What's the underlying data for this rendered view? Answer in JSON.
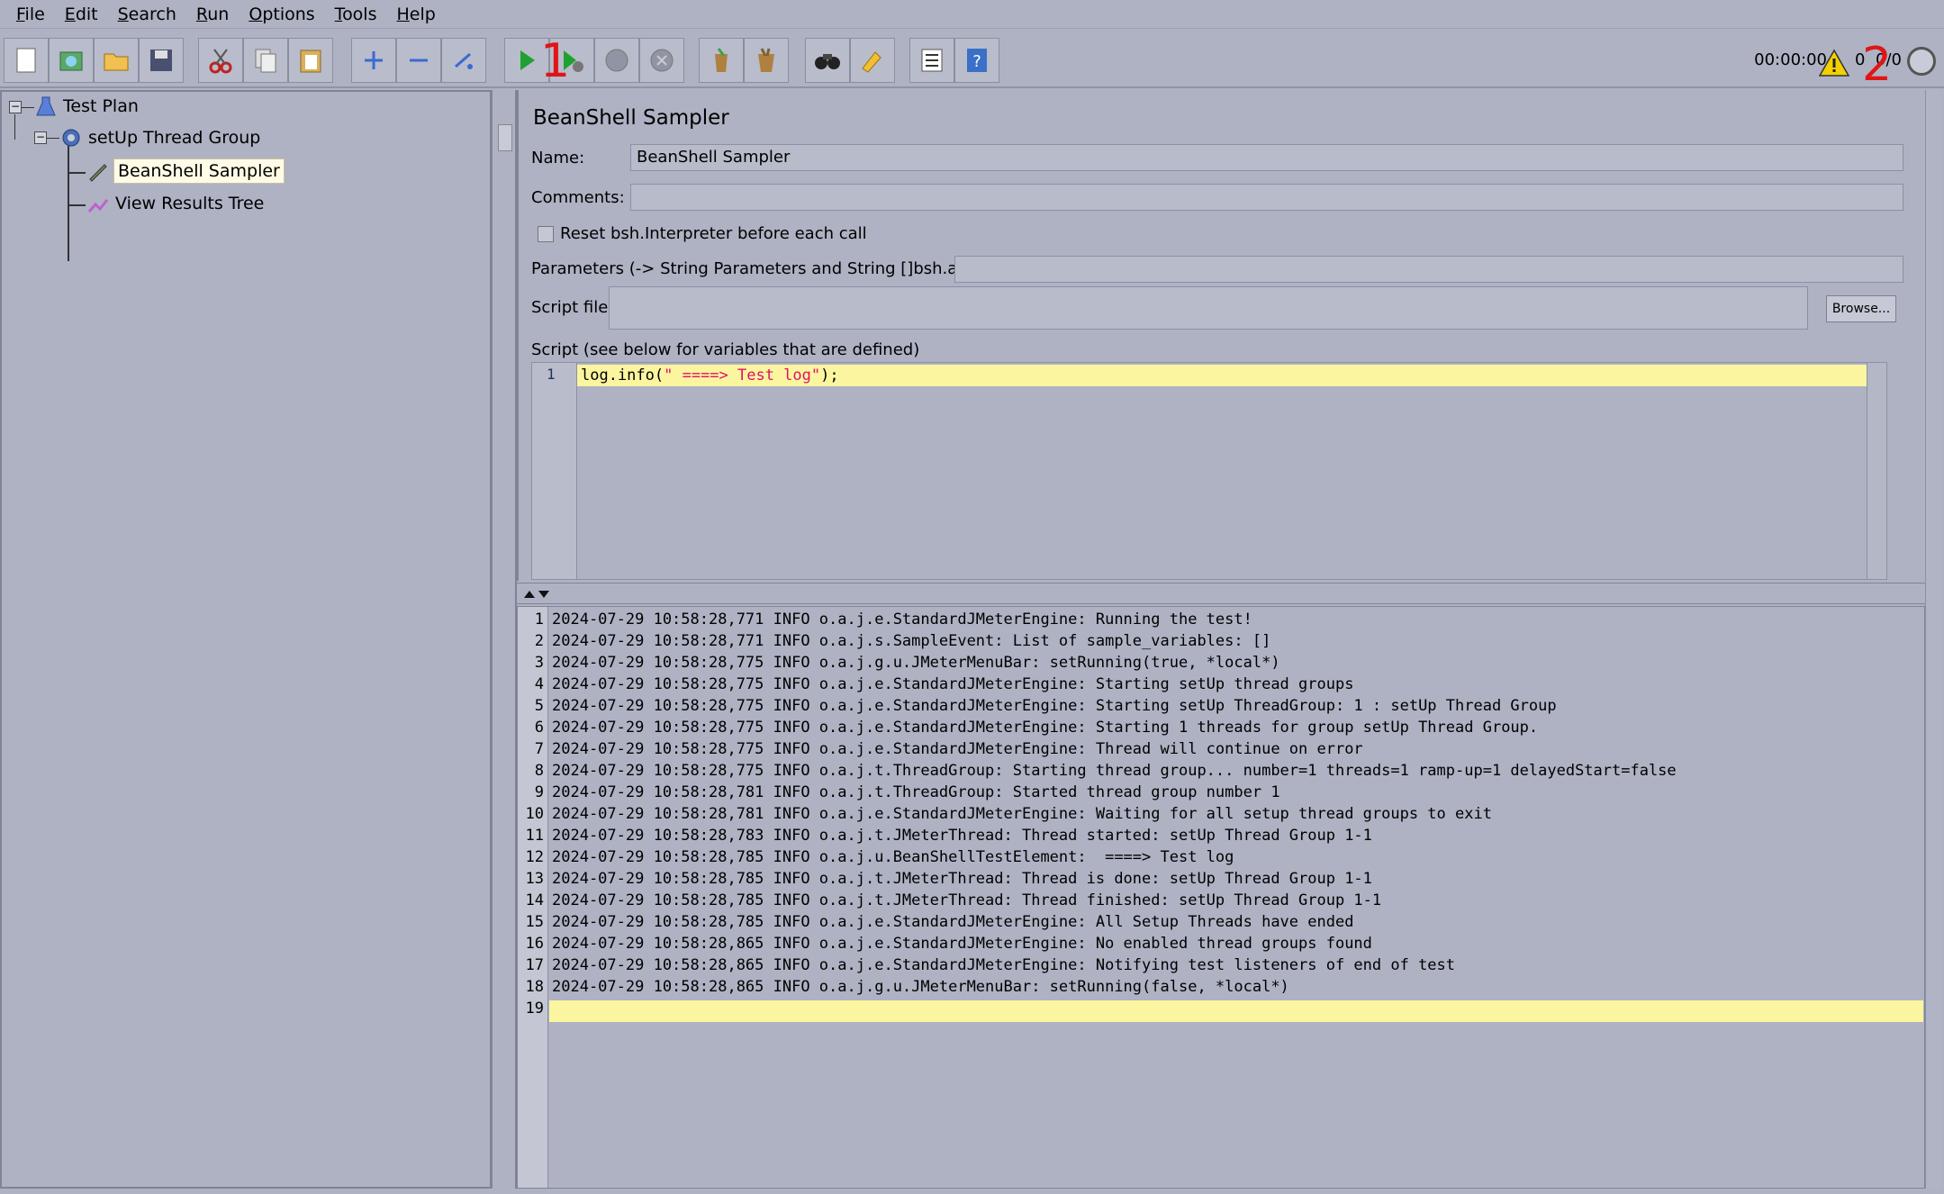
{
  "menu": [
    "File",
    "Edit",
    "Search",
    "Run",
    "Options",
    "Tools",
    "Help"
  ],
  "menu_mnemonic": [
    "F",
    "E",
    "S",
    "R",
    "O",
    "T",
    "H"
  ],
  "toolbar_icons": [
    "new-icon",
    "templates-icon",
    "open-icon",
    "save-icon",
    "cut-icon",
    "copy-icon",
    "paste-icon",
    "expand-icon",
    "collapse-icon",
    "toggle-icon",
    "start-icon",
    "start-no-pause-icon",
    "stop-icon",
    "shutdown-icon",
    "clear-icon",
    "clear-all-icon",
    "search-icon",
    "reset-search-icon",
    "function-helper-icon",
    "help-icon"
  ],
  "status": {
    "timer": "00:00:00",
    "error_count": "0",
    "threads": "0/0"
  },
  "annotations": [
    "1",
    "2"
  ],
  "tree": {
    "test_plan": "Test Plan",
    "thread_group": "setUp Thread Group",
    "sampler": "BeanShell Sampler",
    "listener": "View Results Tree"
  },
  "editor": {
    "title": "BeanShell Sampler",
    "name_label": "Name:",
    "name_value": "BeanShell Sampler",
    "comments_label": "Comments:",
    "comments_value": "",
    "reset_label": "Reset bsh.Interpreter before each call",
    "params_label": "Parameters (-> String Parameters and String []bsh.args)",
    "params_value": "",
    "script_file_label": "Script file",
    "script_file_value": "",
    "browse_label": "Browse...",
    "script_label": "Script (see below for variables that are defined)",
    "script_line_no": "1",
    "script_code_prefix": "log.info(",
    "script_code_string": "\" ====> Test log\"",
    "script_code_suffix": ");"
  },
  "log_lines": [
    "2024-07-29 10:58:28,771 INFO o.a.j.e.StandardJMeterEngine: Running the test!",
    "2024-07-29 10:58:28,771 INFO o.a.j.s.SampleEvent: List of sample_variables: []",
    "2024-07-29 10:58:28,775 INFO o.a.j.g.u.JMeterMenuBar: setRunning(true, *local*)",
    "2024-07-29 10:58:28,775 INFO o.a.j.e.StandardJMeterEngine: Starting setUp thread groups",
    "2024-07-29 10:58:28,775 INFO o.a.j.e.StandardJMeterEngine: Starting setUp ThreadGroup: 1 : setUp Thread Group",
    "2024-07-29 10:58:28,775 INFO o.a.j.e.StandardJMeterEngine: Starting 1 threads for group setUp Thread Group.",
    "2024-07-29 10:58:28,775 INFO o.a.j.e.StandardJMeterEngine: Thread will continue on error",
    "2024-07-29 10:58:28,775 INFO o.a.j.t.ThreadGroup: Starting thread group... number=1 threads=1 ramp-up=1 delayedStart=false",
    "2024-07-29 10:58:28,781 INFO o.a.j.t.ThreadGroup: Started thread group number 1",
    "2024-07-29 10:58:28,781 INFO o.a.j.e.StandardJMeterEngine: Waiting for all setup thread groups to exit",
    "2024-07-29 10:58:28,783 INFO o.a.j.t.JMeterThread: Thread started: setUp Thread Group 1-1",
    "2024-07-29 10:58:28,785 INFO o.a.j.u.BeanShellTestElement:  ====> Test log",
    "2024-07-29 10:58:28,785 INFO o.a.j.t.JMeterThread: Thread is done: setUp Thread Group 1-1",
    "2024-07-29 10:58:28,785 INFO o.a.j.t.JMeterThread: Thread finished: setUp Thread Group 1-1",
    "2024-07-29 10:58:28,785 INFO o.a.j.e.StandardJMeterEngine: All Setup Threads have ended",
    "2024-07-29 10:58:28,865 INFO o.a.j.e.StandardJMeterEngine: No enabled thread groups found",
    "2024-07-29 10:58:28,865 INFO o.a.j.e.StandardJMeterEngine: Notifying test listeners of end of test",
    "2024-07-29 10:58:28,865 INFO o.a.j.g.u.JMeterMenuBar: setRunning(false, *local*)",
    ""
  ],
  "colors": {
    "background": "#aeb2c3",
    "highlight": "#fbf5a0",
    "annotation": "#e01515",
    "string": "#e0106a"
  }
}
